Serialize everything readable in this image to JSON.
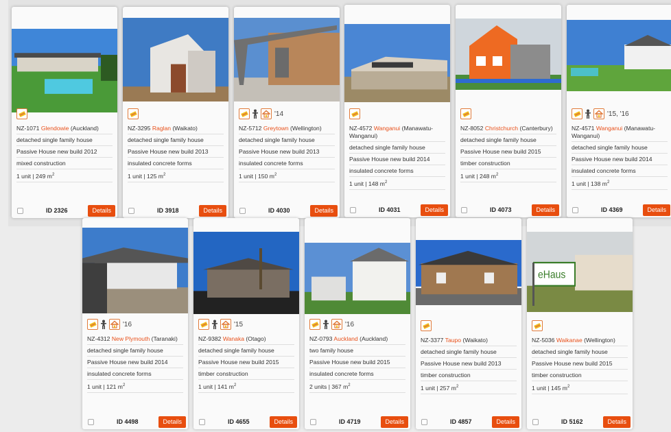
{
  "detail_label": "Details",
  "area_unit": "m",
  "area_exp": "2",
  "cards": [
    {
      "id_label": "ID 2326",
      "code": "NZ-1071",
      "city": "Glendowie",
      "region": " (Auckland)",
      "house_type": "detached single family house",
      "standard": "Passive House new build 2012",
      "construction": "mixed construction",
      "units": "1 unit | 249 ",
      "years": ""
    },
    {
      "id_label": "ID 3918",
      "code": "NZ-3295",
      "city": "Raglan",
      "region": " (Waikato)",
      "house_type": "detached single family house",
      "standard": "Passive House new build 2013",
      "construction": "insulated concrete forms",
      "units": "1 unit | 125 ",
      "years": ""
    },
    {
      "id_label": "ID 4030",
      "code": "NZ-5712",
      "city": "Greytown",
      "region": " (Wellington)",
      "house_type": "detached single family house",
      "standard": "Passive House new build 2013",
      "construction": "insulated concrete forms",
      "units": "1 unit | 150 ",
      "years": "'14"
    },
    {
      "id_label": "ID 4031",
      "code": "NZ-4572",
      "city": "Wanganui",
      "region": " (Manawatu-Wanganui)",
      "house_type": "detached single family house",
      "standard": "Passive House new build 2014",
      "construction": "insulated concrete forms",
      "units": "1 unit | 148 ",
      "years": ""
    },
    {
      "id_label": "ID 4073",
      "code": "NZ-8052",
      "city": "Christchurch",
      "region": " (Canterbury)",
      "house_type": "detached single family house",
      "standard": "Passive House new build 2015",
      "construction": "timber construction",
      "units": "1 unit | 248 ",
      "years": ""
    },
    {
      "id_label": "ID 4369",
      "code": "NZ-4571",
      "city": "Wanganui",
      "region": " (Manawatu-Wanganui)",
      "house_type": "detached single family house",
      "standard": "Passive House new build 2014",
      "construction": "insulated concrete forms",
      "units": "1 unit | 138 ",
      "years": "'15, '16"
    },
    {
      "id_label": "ID 4498",
      "code": "NZ-4312",
      "city": "New Plymouth",
      "region": " (Taranaki)",
      "house_type": "detached single family house",
      "standard": "Passive House new build 2014",
      "construction": "insulated concrete forms",
      "units": "1 unit | 121 ",
      "years": "'16"
    },
    {
      "id_label": "ID 4655",
      "code": "NZ-9382",
      "city": "Wanaka",
      "region": " (Otago)",
      "house_type": "detached single family house",
      "standard": "Passive House new build 2015",
      "construction": "timber construction",
      "units": "1 unit | 141 ",
      "years": "'15"
    },
    {
      "id_label": "ID 4719",
      "code": "NZ-0793",
      "city": "Auckland",
      "region": " (Auckland)",
      "house_type": "two family house",
      "standard": "Passive House new build 2015",
      "construction": "insulated concrete forms",
      "units": "2 units | 367 ",
      "years": "'16"
    },
    {
      "id_label": "ID 4857",
      "code": "NZ-3377",
      "city": "Taupo",
      "region": " (Waikato)",
      "house_type": "detached single family house",
      "standard": "Passive House new build 2013",
      "construction": "timber construction",
      "units": "1 unit | 257 ",
      "years": ""
    },
    {
      "id_label": "ID 5162",
      "code": "NZ-5036",
      "city": "Waikanae",
      "region": " (Wellington)",
      "house_type": "detached single family house",
      "standard": "Passive House new build 2015",
      "construction": "timber construction",
      "units": "1 unit | 145 ",
      "years": ""
    }
  ],
  "sign_text": "eHaus"
}
